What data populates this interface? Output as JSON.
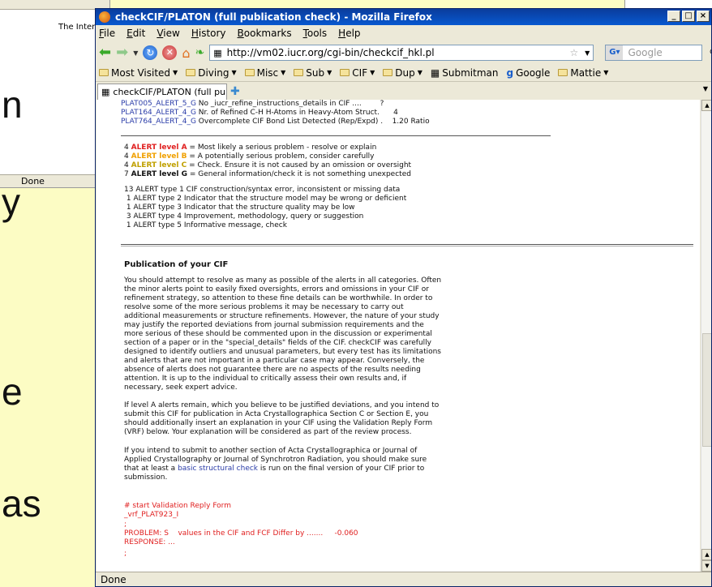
{
  "background": {
    "window_text": "The Intern",
    "window_status": "Done",
    "slide_chars": [
      "n",
      "y",
      "e",
      "as"
    ]
  },
  "firefox": {
    "title": "checkCIF/PLATON (full publication check) - Mozilla Firefox",
    "window_buttons": [
      "_",
      "□",
      "×"
    ],
    "menu": [
      "File",
      "Edit",
      "View",
      "History",
      "Bookmarks",
      "Tools",
      "Help"
    ],
    "url": "http://vm02.iucr.org/cgi-bin/checkcif_hkl.pl",
    "search_placeholder": "Google",
    "bookmarks": [
      "Most Visited",
      "Diving",
      "Misc",
      "Sub",
      "CIF",
      "Dup",
      "Submitman",
      "Google",
      "Mattie"
    ],
    "tab_title": "checkCIF/PLATON (full publicatio...",
    "status": "Done"
  },
  "content": {
    "plat_alerts": [
      {
        "code": "PLAT005_ALERT_5_G",
        "text": " No _iucr_refine_instructions_details in CIF ....",
        "value": "        ?"
      },
      {
        "code": "PLAT164_ALERT_4_G",
        "text": " Nr. of Refined C-H H-Atoms in Heavy-Atom Struct.",
        "value": "      4"
      },
      {
        "code": "PLAT764_ALERT_4_G",
        "text": " Overcomplete CIF Bond List Detected (Rep/Expd) .",
        "value": "    1.20 Ratio"
      }
    ],
    "alert_levels": [
      {
        "count": "4",
        "level_label": "ALERT level A",
        "description": " = Most likely a serious problem - resolve or explain",
        "color": "#e02020"
      },
      {
        "count": "4",
        "level_label": "ALERT level B",
        "description": " = A potentially serious problem, consider carefully",
        "color": "#f0a000"
      },
      {
        "count": "4",
        "level_label": "ALERT level C",
        "description": " = Check. Ensure it is not caused by an omission or oversight",
        "color": "#c0a000"
      },
      {
        "count": "7",
        "level_label": "ALERT level G",
        "description": " = General information/check it is not something unexpected",
        "color": "#111111"
      }
    ],
    "alert_types": [
      "13 ALERT type 1 CIF construction/syntax error, inconsistent or missing data",
      " 1 ALERT type 2 Indicator that the structure model may be wrong or deficient",
      " 1 ALERT type 3 Indicator that the structure quality may be low",
      " 3 ALERT type 4 Improvement, methodology, query or suggestion",
      " 1 ALERT type 5 Informative message, check"
    ],
    "publication_heading": "Publication of your CIF",
    "para1_lines": [
      "You should attempt to resolve as many as possible of the alerts in all categories. Often",
      "the minor alerts point to easily fixed oversights, errors and omissions in your CIF or",
      "refinement strategy, so attention to these fine details can be worthwhile. In order to",
      "resolve some of the more serious problems it may be necessary to carry out",
      "additional measurements or structure refinements. However, the nature of your study",
      "may justify the reported deviations from journal submission requirements and the",
      "more serious of these should be commented upon in the discussion or experimental",
      "section of a paper or in the \"special_details\" fields of the CIF. checkCIF was carefully",
      "designed to identify outliers and unusual parameters, but every test has its limitations",
      "and alerts that are not important in a particular case may appear. Conversely, the",
      "absence of alerts does not guarantee there are no aspects of the results needing",
      "attention. It is up to the individual to critically assess their own results and, if",
      "necessary, seek expert advice."
    ],
    "para2_lines": [
      "If level A alerts remain, which you believe to be justified deviations, and you intend to",
      "submit this CIF for publication in Acta Crystallographica Section C or Section E, you",
      "should additionally insert an explanation in your CIF using the Validation Reply Form",
      "(VRF) below. Your explanation will be considered as part of the review process."
    ],
    "para3_lines": [
      "If you intend to submit to another section of Acta Crystallographica or Journal of",
      "Applied Crystallography or Journal of Synchrotron Radiation, you should make sure",
      "that at least a ",
      "basic structural check",
      " is run on the final version of your CIF prior to",
      "submission."
    ],
    "vrf_lines": [
      "# start Validation Reply Form",
      "_vrf_PLAT923_I",
      ";",
      "PROBLEM: S    values in the CIF and FCF Differ by .......     -0.060",
      "RESPONSE: ...",
      ";"
    ]
  }
}
